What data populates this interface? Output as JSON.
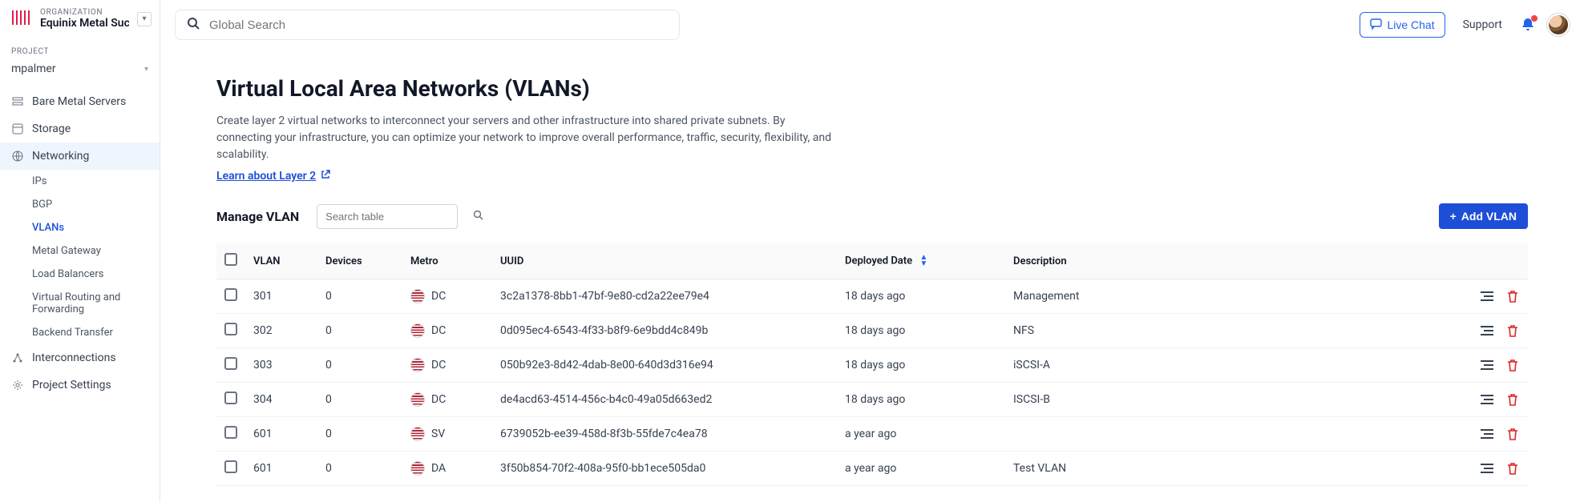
{
  "org": {
    "label": "ORGANIZATION",
    "name": "Equinix Metal Succes"
  },
  "project": {
    "label": "PROJECT",
    "name": "mpalmer"
  },
  "nav": {
    "bare_metal": "Bare Metal Servers",
    "storage": "Storage",
    "networking": "Networking",
    "interconnections": "Interconnections",
    "project_settings": "Project Settings",
    "sub": {
      "ips": "IPs",
      "bgp": "BGP",
      "vlans": "VLANs",
      "metal_gateway": "Metal Gateway",
      "load_balancers": "Load Balancers",
      "vrf": "Virtual Routing and Forwarding",
      "backend_transfer": "Backend Transfer"
    }
  },
  "search": {
    "placeholder": "Global Search"
  },
  "topbar": {
    "live_chat": "Live Chat",
    "support": "Support"
  },
  "page": {
    "title": "Virtual Local Area Networks (VLANs)",
    "desc": "Create layer 2 virtual networks to interconnect your servers and other infrastructure into shared private subnets. By connecting your infrastructure, you can optimize your network to improve overall performance, traffic, security, flexibility, and scalability.",
    "learn": "Learn about Layer 2",
    "manage": "Manage VLAN",
    "table_search_placeholder": "Search table",
    "add_btn": "Add VLAN"
  },
  "columns": {
    "vlan": "VLAN",
    "devices": "Devices",
    "metro": "Metro",
    "uuid": "UUID",
    "deployed": "Deployed Date",
    "description": "Description"
  },
  "rows": [
    {
      "vlan": "301",
      "devices": "0",
      "metro": "DC",
      "uuid": "3c2a1378-8bb1-47bf-9e80-cd2a22ee79e4",
      "deployed": "18 days ago",
      "description": "Management"
    },
    {
      "vlan": "302",
      "devices": "0",
      "metro": "DC",
      "uuid": "0d095ec4-6543-4f33-b8f9-6e9bdd4c849b",
      "deployed": "18 days ago",
      "description": "NFS"
    },
    {
      "vlan": "303",
      "devices": "0",
      "metro": "DC",
      "uuid": "050b92e3-8d42-4dab-8e00-640d3d316e94",
      "deployed": "18 days ago",
      "description": "iSCSI-A"
    },
    {
      "vlan": "304",
      "devices": "0",
      "metro": "DC",
      "uuid": "de4acd63-4514-456c-b4c0-49a05d663ed2",
      "deployed": "18 days ago",
      "description": "ISCSI-B"
    },
    {
      "vlan": "601",
      "devices": "0",
      "metro": "SV",
      "uuid": "6739052b-ee39-458d-8f3b-55fde7c4ea78",
      "deployed": "a year ago",
      "description": ""
    },
    {
      "vlan": "601",
      "devices": "0",
      "metro": "DA",
      "uuid": "3f50b854-70f2-408a-95f0-bb1ece505da0",
      "deployed": "a year ago",
      "description": "Test VLAN"
    }
  ]
}
